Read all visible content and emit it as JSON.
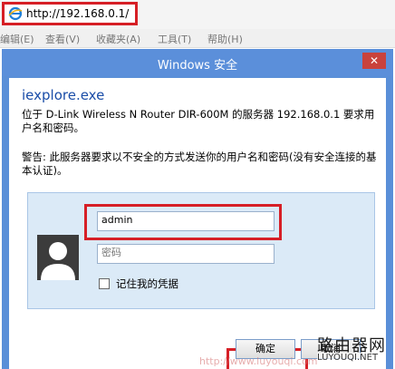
{
  "browser": {
    "url": "http://192.168.0.1/",
    "menu": [
      "编辑(E)",
      "查看(V)",
      "收藏夹(A)",
      "工具(T)",
      "帮助(H)"
    ]
  },
  "dialog": {
    "title": "Windows 安全",
    "close_label": "✕",
    "app_name": "iexplore.exe",
    "description": "位于 D-Link Wireless N Router DIR-600M 的服务器 192.168.0.1 要求用户名和密码。",
    "warning": "警告: 此服务器要求以不安全的方式发送你的用户名和密码(没有安全连接的基本认证)。",
    "username_value": "admin",
    "password_placeholder": "密码",
    "remember_label": "记住我的凭据",
    "ok_label": "确定",
    "cancel_label": "取消"
  },
  "watermark": {
    "cn": "路由器网",
    "en": "LUYOUQI.NET",
    "url": "http://www.luyouqi.com"
  },
  "colors": {
    "highlight": "#d61f26",
    "titlebar": "#5b8fda",
    "panel": "#dbeaf7"
  }
}
